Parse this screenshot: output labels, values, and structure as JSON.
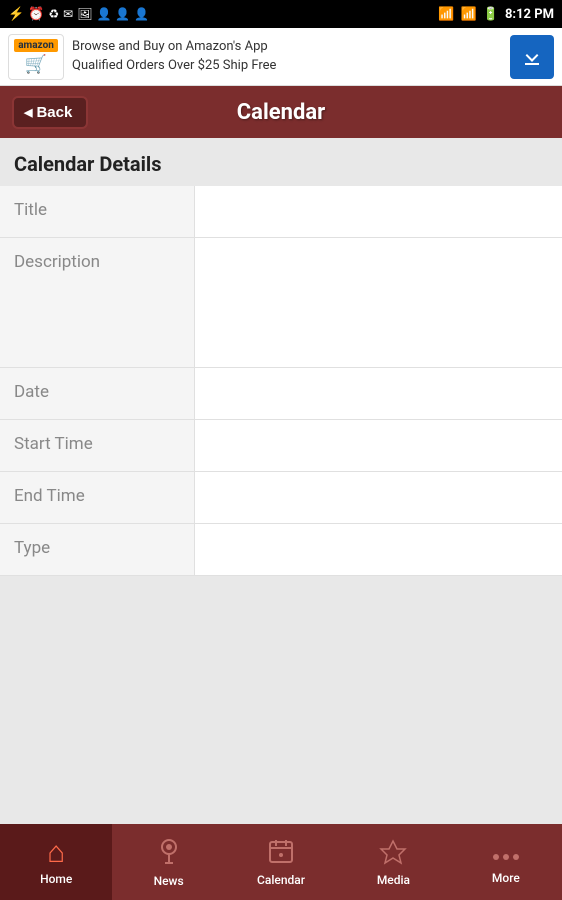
{
  "statusBar": {
    "time": "8:12 PM",
    "icons": [
      "usb",
      "alarm",
      "recycle",
      "email",
      "image",
      "user1",
      "user2",
      "user3"
    ]
  },
  "adBanner": {
    "logoText": "amazon",
    "line1": "Browse and Buy on Amazon's App",
    "line2": "Qualified Orders Over $25 Ship Free",
    "downloadLabel": "download"
  },
  "navBar": {
    "backLabel": "Back",
    "title": "Calendar"
  },
  "content": {
    "sectionHeader": "Calendar Details",
    "formRows": [
      {
        "label": "Title",
        "value": ""
      },
      {
        "label": "Description",
        "value": ""
      },
      {
        "label": "Date",
        "value": ""
      },
      {
        "label": "Start Time",
        "value": ""
      },
      {
        "label": "End Time",
        "value": ""
      },
      {
        "label": "Type",
        "value": ""
      }
    ]
  },
  "bottomNav": {
    "items": [
      {
        "id": "home",
        "label": "Home",
        "active": true,
        "icon": "house"
      },
      {
        "id": "news",
        "label": "News",
        "active": false,
        "icon": "news"
      },
      {
        "id": "calendar",
        "label": "Calendar",
        "active": false,
        "icon": "calendar"
      },
      {
        "id": "media",
        "label": "Media",
        "active": false,
        "icon": "media"
      },
      {
        "id": "more",
        "label": "More",
        "active": false,
        "icon": "dots"
      }
    ]
  }
}
